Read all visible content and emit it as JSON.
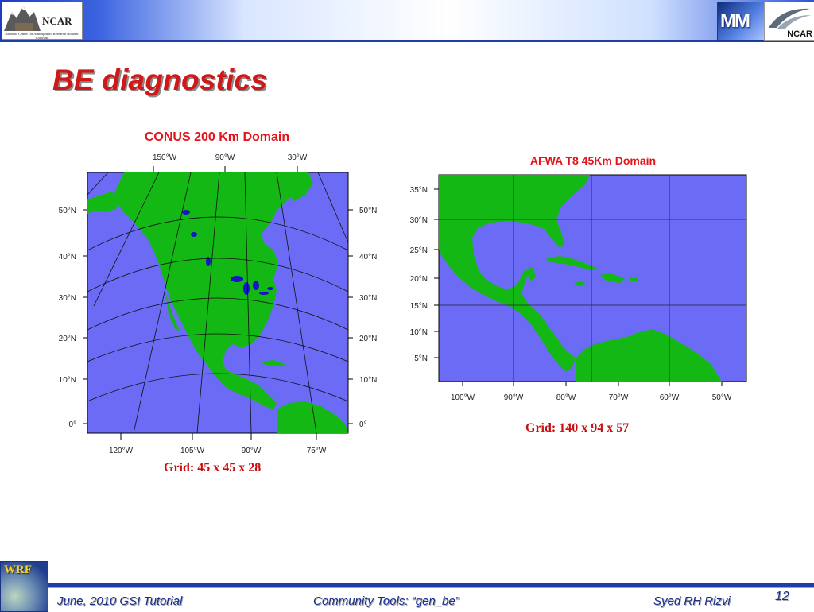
{
  "header": {
    "left_logo_text": "NCAR",
    "left_logo_subtitle": "National Center for Atmospheric Research Boulder, Colorado",
    "right_logo_mm": "MM",
    "right_logo_text": "NCAR"
  },
  "slide": {
    "title": "BE diagnostics"
  },
  "map_conus": {
    "title": "CONUS 200 Km Domain",
    "top_lon_labels": [
      "150°W",
      "90°W",
      "30°W"
    ],
    "bottom_lon_labels": [
      "120°W",
      "105°W",
      "90°W",
      "75°W"
    ],
    "lat_labels": [
      "50°N",
      "40°N",
      "30°N",
      "20°N",
      "10°N",
      "0°"
    ],
    "caption": "Grid: 45 x 45 x 28",
    "colors": {
      "ocean": "#6b6bf5",
      "land": "#14b814",
      "lakes": "#1515c8"
    }
  },
  "map_afwa": {
    "title": "AFWA T8 45Km Domain",
    "lat_labels": [
      "35°N",
      "30°N",
      "25°N",
      "20°N",
      "15°N",
      "10°N",
      "5°N"
    ],
    "lon_labels": [
      "100°W",
      "90°W",
      "80°W",
      "70°W",
      "60°W",
      "50°W"
    ],
    "caption": "Grid: 140 x 94 x 57",
    "colors": {
      "ocean": "#6b6bf5",
      "land": "#14b814"
    }
  },
  "footer": {
    "left": "June, 2010 GSI Tutorial",
    "center": "Community Tools: “gen_be”",
    "right": "Syed RH Rizvi",
    "page_number": "12",
    "wrf_logo_text": "WRF"
  }
}
